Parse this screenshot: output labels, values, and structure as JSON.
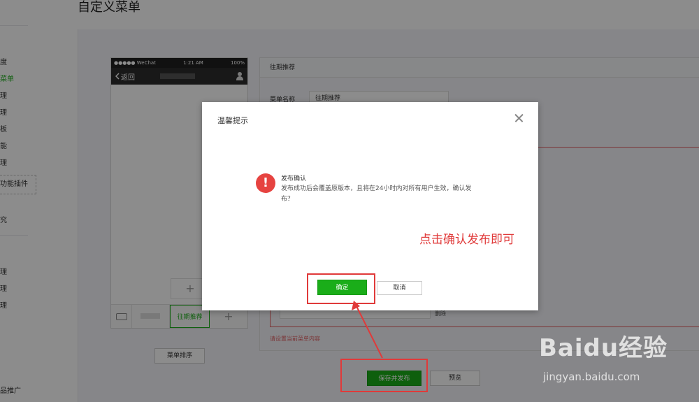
{
  "page": {
    "title": "自定义菜单"
  },
  "left_nav": {
    "items": [
      "度",
      "菜单",
      "理",
      "理",
      "板",
      "能",
      "理"
    ],
    "active_index": 1,
    "plugin_label": "功能插件",
    "more_items": [
      "究"
    ],
    "lower_items": [
      "理",
      "理",
      "理"
    ],
    "bottom_item": "品推广"
  },
  "phone": {
    "status_left": "●●●●● WeChat",
    "status_time": "1:21 AM",
    "status_battery": "100%",
    "back_label": "返回",
    "add_sub_label": "+",
    "active_menu": "往期推荐",
    "add_menu_label": "+"
  },
  "sort_button": "菜单排序",
  "edit_panel": {
    "header": "往期推荐",
    "name_label": "菜单名称",
    "name_value": "往期推荐",
    "delete_label": "删除",
    "error_text": "请设置当前菜单内容"
  },
  "actions": {
    "publish": "保存并发布",
    "preview": "预览"
  },
  "modal": {
    "title": "温馨提示",
    "warn_glyph": "!",
    "msg_title": "发布确认",
    "msg_body": "发布成功后会覆盖原版本，且将在24小时内对所有用户生效，确认发布？",
    "hint": "点击确认发布即可",
    "ok": "确定",
    "cancel": "取消"
  },
  "watermark": {
    "brand": "Baidu经验",
    "url": "jingyan.baidu.com"
  },
  "colors": {
    "green": "#1aad19",
    "annotation_red": "#e03a3a",
    "warn_red": "#e64340"
  }
}
